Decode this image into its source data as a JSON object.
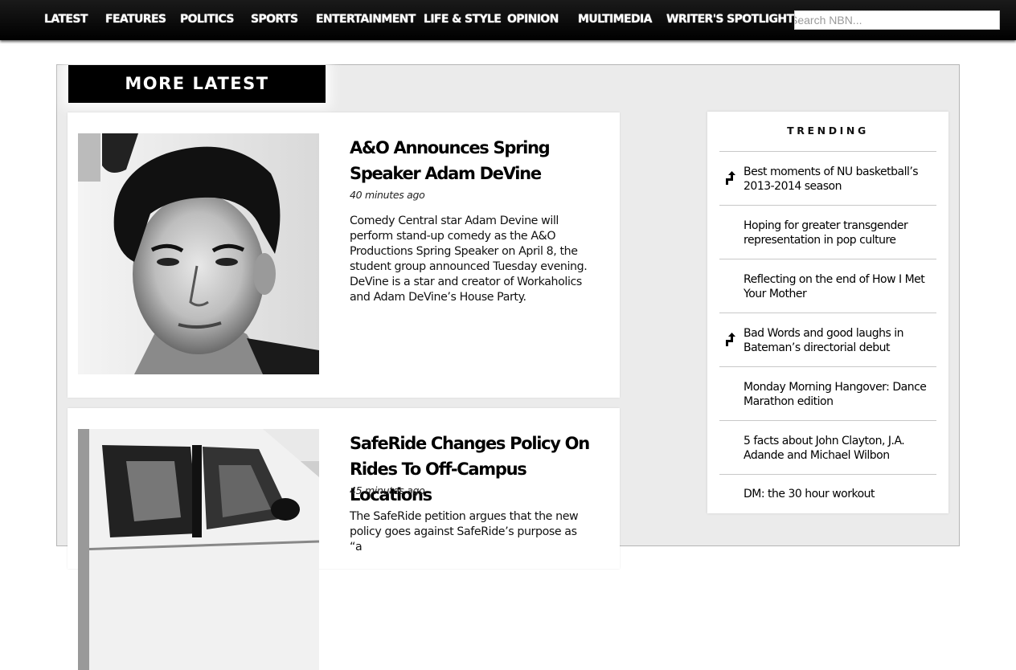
{
  "nav": {
    "items": [
      {
        "label": "LATEST"
      },
      {
        "label": "FEATURES"
      },
      {
        "label": "POLITICS"
      },
      {
        "label": "SPORTS"
      },
      {
        "label": "ENTERTAINMENT"
      },
      {
        "label": "LIFE & STYLE"
      },
      {
        "label": "OPINION"
      },
      {
        "label": "MULTIMEDIA"
      },
      {
        "label": "WRITER'S SPOTLIGHT"
      }
    ],
    "search_placeholder": "Search NBN..."
  },
  "section": {
    "title": "MORE LATEST"
  },
  "articles": [
    {
      "headline": "A&O Announces Spring Speaker Adam DeVine",
      "time": "40 minutes ago",
      "excerpt": "Comedy Central star Adam Devine will perform stand-up comedy as the A&O Productions Spring Speaker on April 8, the student group announced Tuesday evening. DeVine is a star and creator of Workaholics and Adam DeVine’s House Party.",
      "image": "portrait-photo"
    },
    {
      "headline": "SafeRide Changes Policy On Rides To Off-Campus Locations",
      "time": "45 minutes ago",
      "excerpt": "The SafeRide petition argues that the new policy goes against SafeRide’s purpose as “a",
      "image": "car-photo"
    }
  ],
  "trending": {
    "title": "TRENDING",
    "items": [
      {
        "label": "Best moments of NU basketball’s 2013-2014 season",
        "icon": "trending-up-arrow-icon"
      },
      {
        "label": "Hoping for greater transgender representation in pop culture",
        "icon": ""
      },
      {
        "label": "Reflecting on the end of How I Met Your Mother",
        "icon": ""
      },
      {
        "label": "Bad Words and good laughs in Bateman’s directorial debut",
        "icon": "trending-up-arrow-icon"
      },
      {
        "label": "Monday Morning Hangover: Dance Marathon edition",
        "icon": ""
      },
      {
        "label": "5 facts about John Clayton, J.A. Adande and Michael Wilbon",
        "icon": ""
      },
      {
        "label": "DM: the 30 hour workout",
        "icon": ""
      }
    ]
  }
}
